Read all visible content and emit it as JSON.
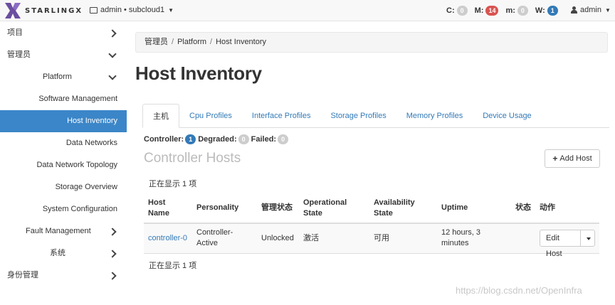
{
  "topbar": {
    "brand": "STARLINGX",
    "context": "admin • subcloud1",
    "alarms": [
      {
        "label": "C:",
        "count": "0",
        "color": "#cdcdcd"
      },
      {
        "label": "M:",
        "count": "14",
        "color": "#d9534f"
      },
      {
        "label": "m:",
        "count": "0",
        "color": "#cdcdcd"
      },
      {
        "label": "W:",
        "count": "1",
        "color": "#337ab7"
      }
    ],
    "user": "admin"
  },
  "sidebar": {
    "items": [
      {
        "label": "项目",
        "icon": "chevron-right-icon"
      },
      {
        "label": "管理员",
        "icon": "chevron-down-icon"
      },
      {
        "label": "Platform",
        "icon": "chevron-down-icon"
      },
      {
        "label": "Software Management"
      },
      {
        "label": "Host Inventory",
        "active": true
      },
      {
        "label": "Data Networks"
      },
      {
        "label": "Data Network Topology"
      },
      {
        "label": "Storage Overview"
      },
      {
        "label": "System Configuration"
      },
      {
        "label": "Fault Management",
        "icon": "chevron-right-icon"
      },
      {
        "label": "系统",
        "icon": "chevron-right-icon"
      },
      {
        "label": "身份管理",
        "icon": "chevron-right-icon"
      }
    ]
  },
  "breadcrumb": [
    "管理员",
    "Platform",
    "Host Inventory"
  ],
  "page_title": "Host Inventory",
  "tabs": [
    "主机",
    "Cpu Profiles",
    "Interface Profiles",
    "Storage Profiles",
    "Memory Profiles",
    "Device Usage"
  ],
  "summary": {
    "controller_label": "Controller:",
    "controller_count": "1",
    "degraded_label": "Degraded:",
    "degraded_count": "0",
    "failed_label": "Failed:",
    "failed_count": "0"
  },
  "section_title": "Controller Hosts",
  "add_host_label": "Add Host",
  "count_text": "正在显示 1 项",
  "table": {
    "headers": [
      "Host Name",
      "Personality",
      "管理状态",
      "Operational State",
      "Availability State",
      "Uptime",
      "状态",
      "动作"
    ],
    "rows": [
      {
        "host_name": "controller-0",
        "personality": "Controller-Active",
        "admin_state": "Unlocked",
        "operational_state": "激活",
        "availability_state": "可用",
        "uptime": "12 hours, 3 minutes",
        "status": "",
        "action_label": "Edit Host"
      }
    ]
  },
  "watermark": "https://blog.csdn.net/OpenInfra"
}
